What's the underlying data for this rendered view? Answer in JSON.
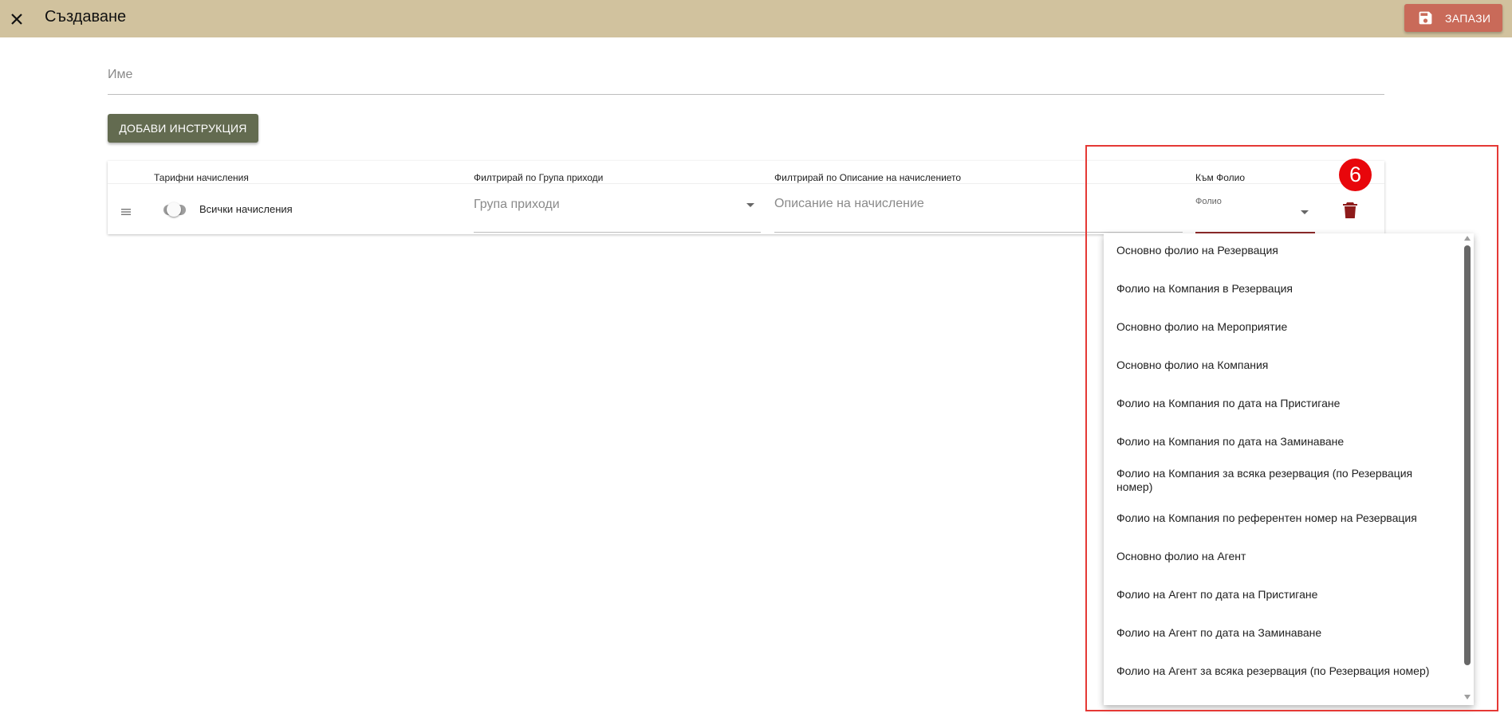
{
  "header": {
    "title": "Създаване",
    "save_label": "ЗАПАЗИ",
    "close_icon": "close-icon",
    "save_icon": "floppy-disk-icon"
  },
  "form": {
    "name_placeholder": "Име",
    "add_instruction_label": "ДОБАВИ ИНСТРУКЦИЯ"
  },
  "table": {
    "columns": [
      "Тарифни начисления",
      "Филтрирай по Група приходи",
      "Филтрирай по Описание на начислението",
      "Към Фолио"
    ],
    "row": {
      "toggle_label": "Всички начисления",
      "toggle_on": false,
      "revenue_group_placeholder": "Група приходи",
      "charge_description_placeholder": "Описание на начисление",
      "folio_label": "Фолио"
    }
  },
  "annotation": {
    "step": "6"
  },
  "folio_options": [
    "Основно фолио на Резервация",
    "Фолио на Компания в Резервация",
    "Основно фолио на Мероприятие",
    "Основно фолио на Компания",
    "Фолио на Компания по дата на Пристигане",
    "Фолио на Компания по дата на Заминаване",
    "Фолио на Компания за всяка резервация (по Резервация номер)",
    "Фолио на Компания по референтен номер на Резервация",
    "Основно фолио на Агент",
    "Фолио на Агент по дата на Пристигане",
    "Фолио на Агент по дата на Заминаване",
    "Фолио на Агент за всяка резервация (по Резервация номер)"
  ],
  "colors": {
    "topbar": "#d1c29e",
    "save_button": "#c96a59",
    "add_button": "#636b50",
    "delete_icon": "#8e1b1b",
    "highlight": "#e53935",
    "badge": "#e8060b"
  }
}
